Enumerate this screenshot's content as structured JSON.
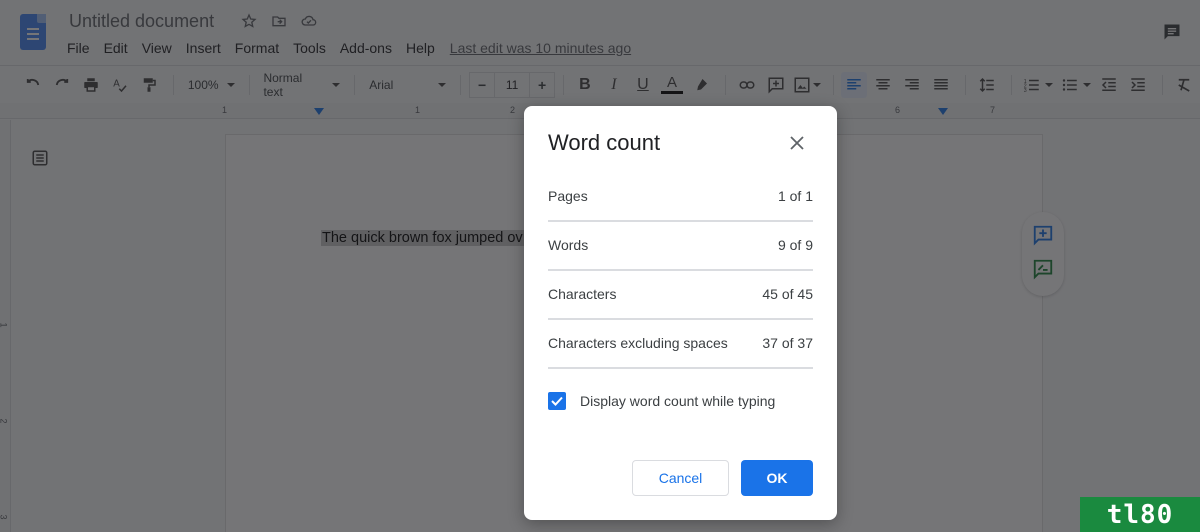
{
  "header": {
    "title": "Untitled document",
    "title_icons": [
      "star-icon",
      "move-to-folder-icon",
      "cloud-saved-icon"
    ],
    "menu": [
      "File",
      "Edit",
      "View",
      "Insert",
      "Format",
      "Tools",
      "Add-ons",
      "Help"
    ],
    "last_edit": "Last edit was 10 minutes ago"
  },
  "toolbar": {
    "zoom": "100%",
    "style": "Normal text",
    "font": "Arial",
    "font_size": "11",
    "minus_label": "−",
    "plus_label": "+",
    "bold_label": "B",
    "italic_label": "I",
    "underline_label": "U",
    "text_color_label": "A",
    "text_color": "#000000",
    "alignment": "left"
  },
  "ruler": {
    "horizontal_labels": [
      "1",
      "1",
      "2",
      "6",
      "7"
    ],
    "vertical_labels": [
      "1",
      "2",
      "3"
    ]
  },
  "document": {
    "text": "The quick brown fox jumped ov"
  },
  "dialog": {
    "title": "Word count",
    "stats": [
      {
        "label": "Pages",
        "value": "1 of 1"
      },
      {
        "label": "Words",
        "value": "9 of 9"
      },
      {
        "label": "Characters",
        "value": "45 of 45"
      },
      {
        "label": "Characters excluding spaces",
        "value": "37 of 37"
      }
    ],
    "checkbox_label": "Display word count while typing",
    "checkbox_checked": true,
    "cancel_label": "Cancel",
    "ok_label": "OK",
    "accent_color": "#1a73e8"
  },
  "watermark": {
    "text": "tl80"
  }
}
